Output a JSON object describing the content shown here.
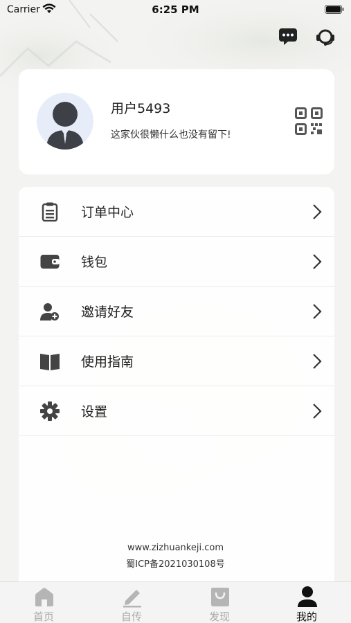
{
  "status_bar": {
    "carrier": "Carrier",
    "time": "6:25 PM"
  },
  "header": {
    "icons": [
      "message-icon",
      "customer-service-icon"
    ]
  },
  "profile": {
    "username": "用户5493",
    "bio": "这家伙很懒什么也没有留下!"
  },
  "menu": {
    "items": [
      {
        "label": "订单中心",
        "icon": "clipboard-icon"
      },
      {
        "label": "钱包",
        "icon": "wallet-icon"
      },
      {
        "label": "邀请好友",
        "icon": "add-user-icon"
      },
      {
        "label": "使用指南",
        "icon": "book-icon"
      },
      {
        "label": "设置",
        "icon": "gear-icon"
      }
    ]
  },
  "footer": {
    "website": "www.zizhuankeji.com",
    "icp": "蜀ICP备2021030108号"
  },
  "tabbar": {
    "tabs": [
      {
        "label": "首页",
        "icon": "home-icon",
        "active": false
      },
      {
        "label": "自传",
        "icon": "pen-icon",
        "active": false
      },
      {
        "label": "发现",
        "icon": "shopping-bag-icon",
        "active": false
      },
      {
        "label": "我的",
        "icon": "user-icon",
        "active": true
      }
    ]
  },
  "colors": {
    "background": "#f3f3f1",
    "card": "#ffffff",
    "icon": "#444444",
    "tab_inactive": "#aaaaaa",
    "tab_active": "#111111"
  }
}
